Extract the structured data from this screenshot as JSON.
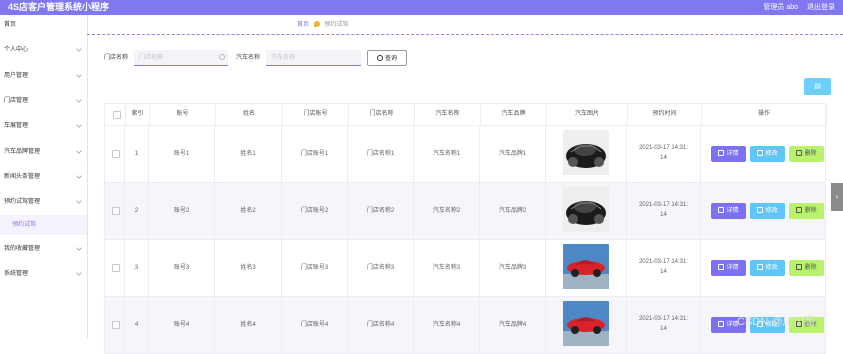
{
  "app": {
    "title": "4S店客户管理系统小程序",
    "user": "管理员 abo",
    "logout": "退出登录"
  },
  "sidebar": {
    "items": [
      {
        "label": "首页",
        "arrow": false
      },
      {
        "label": "个人中心",
        "arrow": true
      },
      {
        "label": "用户管理",
        "arrow": true
      },
      {
        "label": "门店管理",
        "arrow": true
      },
      {
        "label": "车展管理",
        "arrow": true
      },
      {
        "label": "汽车品牌管理",
        "arrow": true
      },
      {
        "label": "新闻头条管理",
        "arrow": true
      },
      {
        "label": "预约试驾管理",
        "arrow": true
      },
      {
        "label": "预约试驾",
        "arrow": false,
        "sub": true
      },
      {
        "label": "我的收藏管理",
        "arrow": true
      },
      {
        "label": "系统管理",
        "arrow": true
      }
    ]
  },
  "breadcrumb": {
    "home": "首页",
    "current": "预约试驾"
  },
  "search": {
    "store_label": "门店名称",
    "store_placeholder": "门店名称",
    "store_value": "",
    "car_label": "汽车名称",
    "car_placeholder": "汽车名称",
    "car_value": "",
    "query_label": "查询"
  },
  "table": {
    "headers": [
      "",
      "索引",
      "账号",
      "姓名",
      "门店账号",
      "门店名称",
      "汽车名称",
      "汽车品牌",
      "汽车图片",
      "预约时间",
      "操作"
    ],
    "rows": [
      {
        "index": "1",
        "account": "账号1",
        "name": "姓名1",
        "store_account": "门店账号1",
        "store_name": "门店名称1",
        "car_name": "汽车名称1",
        "brand": "汽车品牌1",
        "image": "black-car-photo",
        "time_line1": "2021-03-17 14:31:",
        "time_line2": "14"
      },
      {
        "index": "2",
        "account": "账号2",
        "name": "姓名2",
        "store_account": "门店账号2",
        "store_name": "门店名称2",
        "car_name": "汽车名称2",
        "brand": "汽车品牌2",
        "image": "black-car-photo",
        "time_line1": "2021-03-17 14:31:",
        "time_line2": "14"
      },
      {
        "index": "3",
        "account": "账号3",
        "name": "姓名3",
        "store_account": "门店账号3",
        "store_name": "门店名称3",
        "car_name": "汽车名称3",
        "brand": "汽车品牌3",
        "image": "red-car-photo",
        "time_line1": "2021-03-17 14:31:",
        "time_line2": "14"
      },
      {
        "index": "4",
        "account": "账号4",
        "name": "姓名4",
        "store_account": "门店账号4",
        "store_name": "门店名称4",
        "car_name": "汽车名称4",
        "brand": "汽车品牌4",
        "image": "red-car-photo",
        "time_line1": "2021-03-17 14:31:",
        "time_line2": "14"
      }
    ],
    "actions": {
      "detail": "详情",
      "edit": "修改",
      "delete": "删除"
    }
  },
  "watermark": "CSDN @川川哥",
  "colors": {
    "primary": "#7f78f0",
    "detail": "#7d70f2",
    "edit": "#5fc7f6",
    "delete": "#b9f36e",
    "tool": "#6dd0fb"
  }
}
